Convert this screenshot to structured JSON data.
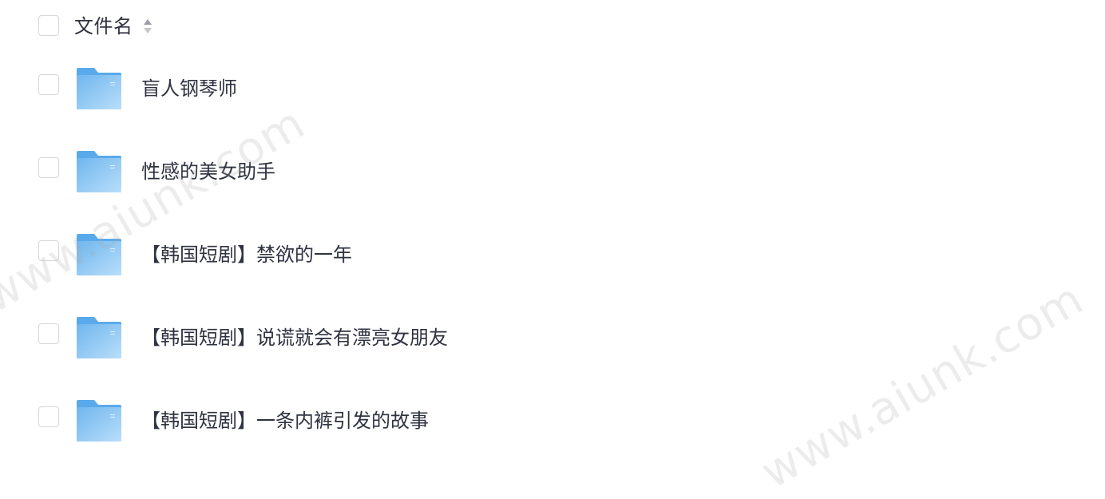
{
  "header": {
    "column_label": "文件名",
    "sort_icon": "sort-icon"
  },
  "files": [
    {
      "name": "盲人钢琴师",
      "icon": "folder-icon"
    },
    {
      "name": "性感的美女助手",
      "icon": "folder-icon"
    },
    {
      "name": "【韩国短剧】禁欲的一年",
      "icon": "folder-icon"
    },
    {
      "name": "【韩国短剧】说谎就会有漂亮女朋友",
      "icon": "folder-icon"
    },
    {
      "name": "【韩国短剧】一条内裤引发的故事",
      "icon": "folder-icon"
    }
  ],
  "watermark": "www.aiunk.com",
  "colors": {
    "text": "#2f3240",
    "checkbox_border": "#d4d6dc",
    "folder_light": "#a9d4f5",
    "folder_dark": "#5aaaeb"
  }
}
